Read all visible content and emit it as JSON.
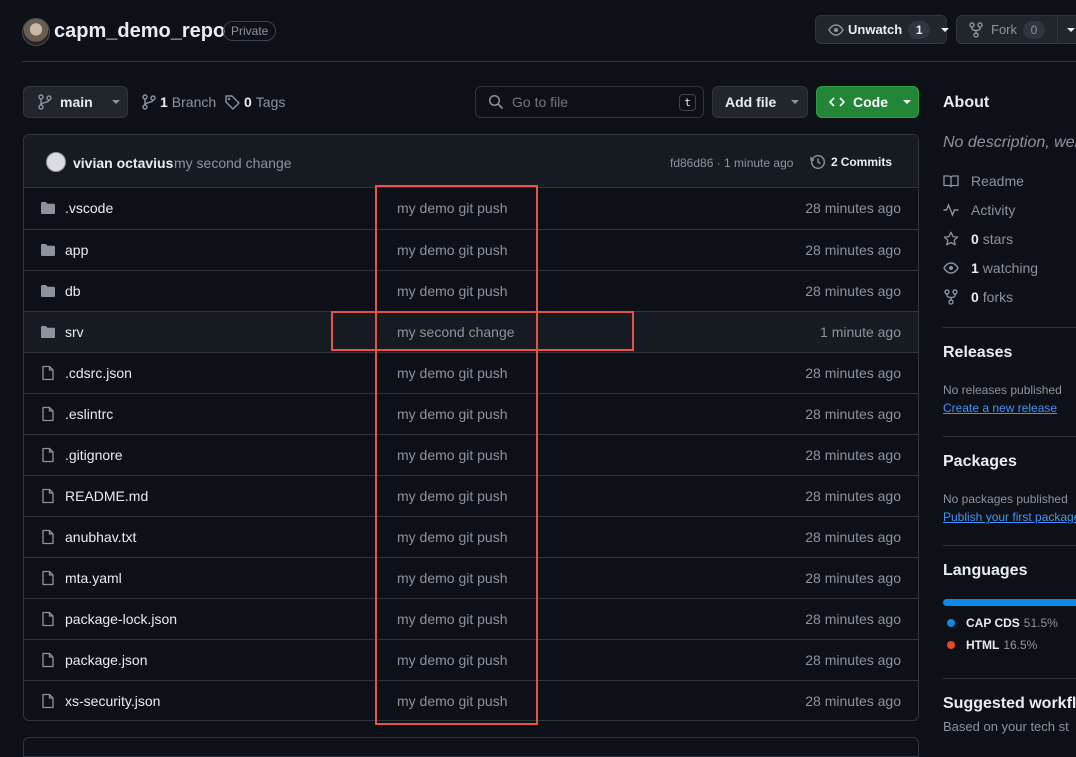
{
  "repo": {
    "name": "capm_demo_repo",
    "visibility": "Private"
  },
  "actions": {
    "unwatch_label": "Unwatch",
    "unwatch_count": "1",
    "fork_label": "Fork",
    "fork_count": "0"
  },
  "toolbar": {
    "branch": "main",
    "branches_count": "1",
    "branches_label": "Branch",
    "tags_count": "0",
    "tags_label": "Tags",
    "search_placeholder": "Go to file",
    "search_shortcut": "t",
    "add_file_label": "Add file",
    "code_label": "Code"
  },
  "latest_commit": {
    "author": "vivian octavius",
    "message": "my second change",
    "sha_time": "fd86d86 · 1 minute ago",
    "commits_count": "2",
    "commits_label": "Commits"
  },
  "files": [
    {
      "name": ".vscode",
      "type": "folder",
      "message": "my demo git push",
      "time": "28 minutes ago"
    },
    {
      "name": "app",
      "type": "folder",
      "message": "my demo git push",
      "time": "28 minutes ago"
    },
    {
      "name": "db",
      "type": "folder",
      "message": "my demo git push",
      "time": "28 minutes ago"
    },
    {
      "name": "srv",
      "type": "folder",
      "message": "my second change",
      "time": "1 minute ago"
    },
    {
      "name": ".cdsrc.json",
      "type": "file",
      "message": "my demo git push",
      "time": "28 minutes ago"
    },
    {
      "name": ".eslintrc",
      "type": "file",
      "message": "my demo git push",
      "time": "28 minutes ago"
    },
    {
      "name": ".gitignore",
      "type": "file",
      "message": "my demo git push",
      "time": "28 minutes ago"
    },
    {
      "name": "README.md",
      "type": "file",
      "message": "my demo git push",
      "time": "28 minutes ago"
    },
    {
      "name": "anubhav.txt",
      "type": "file",
      "message": "my demo git push",
      "time": "28 minutes ago"
    },
    {
      "name": "mta.yaml",
      "type": "file",
      "message": "my demo git push",
      "time": "28 minutes ago"
    },
    {
      "name": "package-lock.json",
      "type": "file",
      "message": "my demo git push",
      "time": "28 minutes ago"
    },
    {
      "name": "package.json",
      "type": "file",
      "message": "my demo git push",
      "time": "28 minutes ago"
    },
    {
      "name": "xs-security.json",
      "type": "file",
      "message": "my demo git push",
      "time": "28 minutes ago"
    }
  ],
  "about": {
    "title": "About",
    "description": "No description, web",
    "readme": "Readme",
    "activity": "Activity",
    "stars_count": "0",
    "stars_label": "stars",
    "watching_count": "1",
    "watching_label": "watching",
    "forks_count": "0",
    "forks_label": "forks"
  },
  "releases": {
    "title": "Releases",
    "empty_text": "No releases published",
    "link": "Create a new release"
  },
  "packages": {
    "title": "Packages",
    "empty_text": "No packages published",
    "link": "Publish your first package"
  },
  "languages": {
    "title": "Languages",
    "items": [
      {
        "name": "CAP CDS",
        "percent": "51.5%",
        "share": 0.515,
        "color": "#0d8ae5"
      },
      {
        "name": "HTML",
        "percent": "16.5%",
        "share": 0.165,
        "color": "#e34c26"
      }
    ]
  },
  "suggested": {
    "title": "Suggested workflo",
    "subtitle": "Based on your tech st"
  },
  "colors": {
    "accent_green": "#238636",
    "link_blue": "#4493f8",
    "highlight_red": "#e5534b"
  }
}
